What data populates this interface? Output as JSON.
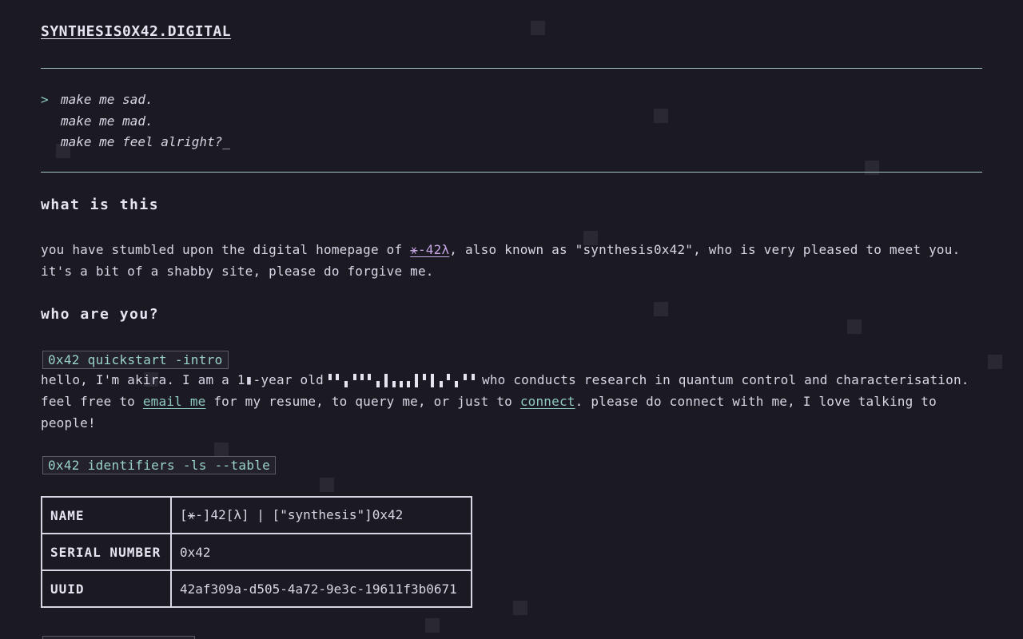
{
  "site": {
    "title": "SYNTHESIS0X42.DIGITAL"
  },
  "quote": {
    "prompt": ">",
    "lines": [
      "make me sad.",
      "make me mad.",
      "make me feel alright?"
    ],
    "cursor": "_"
  },
  "what_is_this": {
    "heading": "what is this",
    "text_before": "you have stumbled upon the digital homepage of ",
    "link": "⚹-42λ",
    "text_after": ", also known as \"synthesis0x42\", who is very pleased to meet you. it's a bit of a shabby site, please do forgive me."
  },
  "who_are_you": {
    "heading": "who are you?",
    "command": "0x42 quickstart -intro",
    "intro_before": "hello, I'm akira. I am a 1▮-year old",
    "intro_after": "who conducts research in quantum control and characterisation.",
    "line2_before": " feel free to ",
    "email_link": "email me",
    "line2_mid": " for my resume, to query me, or just to ",
    "connect_link": "connect",
    "line2_after": ". please do connect with me, I love talking to people!"
  },
  "identifiers": {
    "command": "0x42 identifiers -ls --table",
    "rows": [
      {
        "key": "NAME",
        "value": "[⚹-]42[λ] | [\"synthesis\"]0x42"
      },
      {
        "key": "SERIAL NUMBER",
        "value": "0x42"
      },
      {
        "key": "UUID",
        "value": "42af309a-d505-4a72-9e3c-19611f3b0671"
      }
    ]
  }
}
